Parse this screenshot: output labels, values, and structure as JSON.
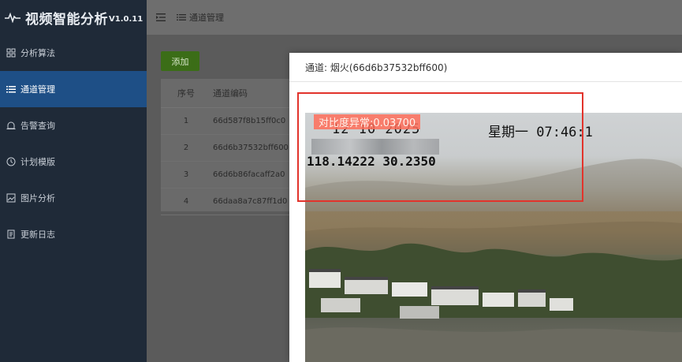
{
  "app": {
    "name": "视频智能分析",
    "version": "V1.0.11"
  },
  "sidebar": {
    "items": [
      {
        "label": "分析算法",
        "icon": "algorithm-icon"
      },
      {
        "label": "通道管理",
        "icon": "list-icon",
        "active": true
      },
      {
        "label": "告警查询",
        "icon": "alarm-icon"
      },
      {
        "label": "计划模版",
        "icon": "clock-icon"
      },
      {
        "label": "图片分析",
        "icon": "image-icon"
      },
      {
        "label": "更新日志",
        "icon": "document-icon"
      }
    ]
  },
  "header": {
    "breadcrumb": "通道管理"
  },
  "toolbar": {
    "add_label": "添加"
  },
  "table": {
    "columns": [
      "序号",
      "通道编码"
    ],
    "rows": [
      {
        "no": "1",
        "code": "66d587f8b15ff0c0"
      },
      {
        "no": "2",
        "code": "66d6b37532bff600"
      },
      {
        "no": "3",
        "code": "66d6b86facaff2a0"
      },
      {
        "no": "4",
        "code": "66daa8a7c87ff1d0"
      }
    ]
  },
  "modal": {
    "title": "通道: 烟火(66d6b37532bff600)",
    "overlay": {
      "date_prefix": "12 10 2025",
      "weekday_time": "星期一 07:46:1",
      "coords": "118.14222  30.2350",
      "alert": "对比度异常:0.03700"
    }
  },
  "colors": {
    "sidebar": "#1f2a38",
    "active": "#1e4f86",
    "add_button": "#3b6d17",
    "highlight": "#e2332b"
  }
}
